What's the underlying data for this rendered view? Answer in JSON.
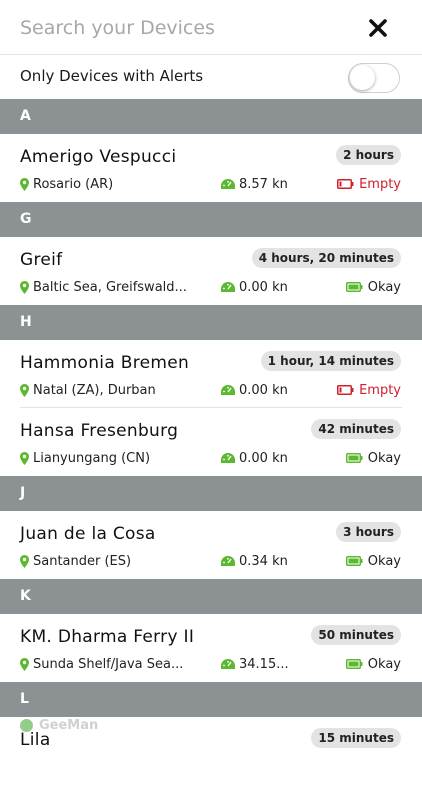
{
  "search": {
    "placeholder": "Search your Devices"
  },
  "alerts_filter": {
    "label": "Only Devices with Alerts",
    "enabled": false
  },
  "colors": {
    "section_header": "#8c9194",
    "location_icon": "#5cb82e",
    "speed_icon": "#5cb82e",
    "battery_ok": "#5cb82e",
    "battery_empty": "#d0202a"
  },
  "watermark": {
    "text": "GeeMan"
  },
  "sections": [
    {
      "letter": "A",
      "devices": [
        {
          "name": "Amerigo Vespucci",
          "time": "2 hours",
          "location": "Rosario (AR)",
          "speed": "8.57 kn",
          "battery": "Empty",
          "battery_state": "empty"
        }
      ]
    },
    {
      "letter": "G",
      "devices": [
        {
          "name": "Greif",
          "time": "4 hours, 20 minutes",
          "location": "Baltic Sea, Greifswald...",
          "speed": "0.00 kn",
          "battery": "Okay",
          "battery_state": "okay"
        }
      ]
    },
    {
      "letter": "H",
      "devices": [
        {
          "name": "Hammonia Bremen",
          "time": "1 hour, 14 minutes",
          "location": "Natal (ZA), Durban",
          "speed": "0.00 kn",
          "battery": "Empty",
          "battery_state": "empty"
        },
        {
          "name": "Hansa Fresenburg",
          "time": "42 minutes",
          "location": "Lianyungang (CN)",
          "speed": "0.00 kn",
          "battery": "Okay",
          "battery_state": "okay"
        }
      ]
    },
    {
      "letter": "J",
      "devices": [
        {
          "name": "Juan de la Cosa",
          "time": "3 hours",
          "location": "Santander (ES)",
          "speed": "0.34 kn",
          "battery": "Okay",
          "battery_state": "okay"
        }
      ]
    },
    {
      "letter": "K",
      "devices": [
        {
          "name": "KM. Dharma Ferry II",
          "time": "50 minutes",
          "location": "Sunda Shelf/Java Sea...",
          "speed": "34.15...",
          "battery": "Okay",
          "battery_state": "okay"
        }
      ]
    },
    {
      "letter": "L",
      "devices": [
        {
          "name": "Lila",
          "time": "15 minutes",
          "location": "",
          "speed": "",
          "battery": "",
          "battery_state": ""
        }
      ]
    }
  ]
}
